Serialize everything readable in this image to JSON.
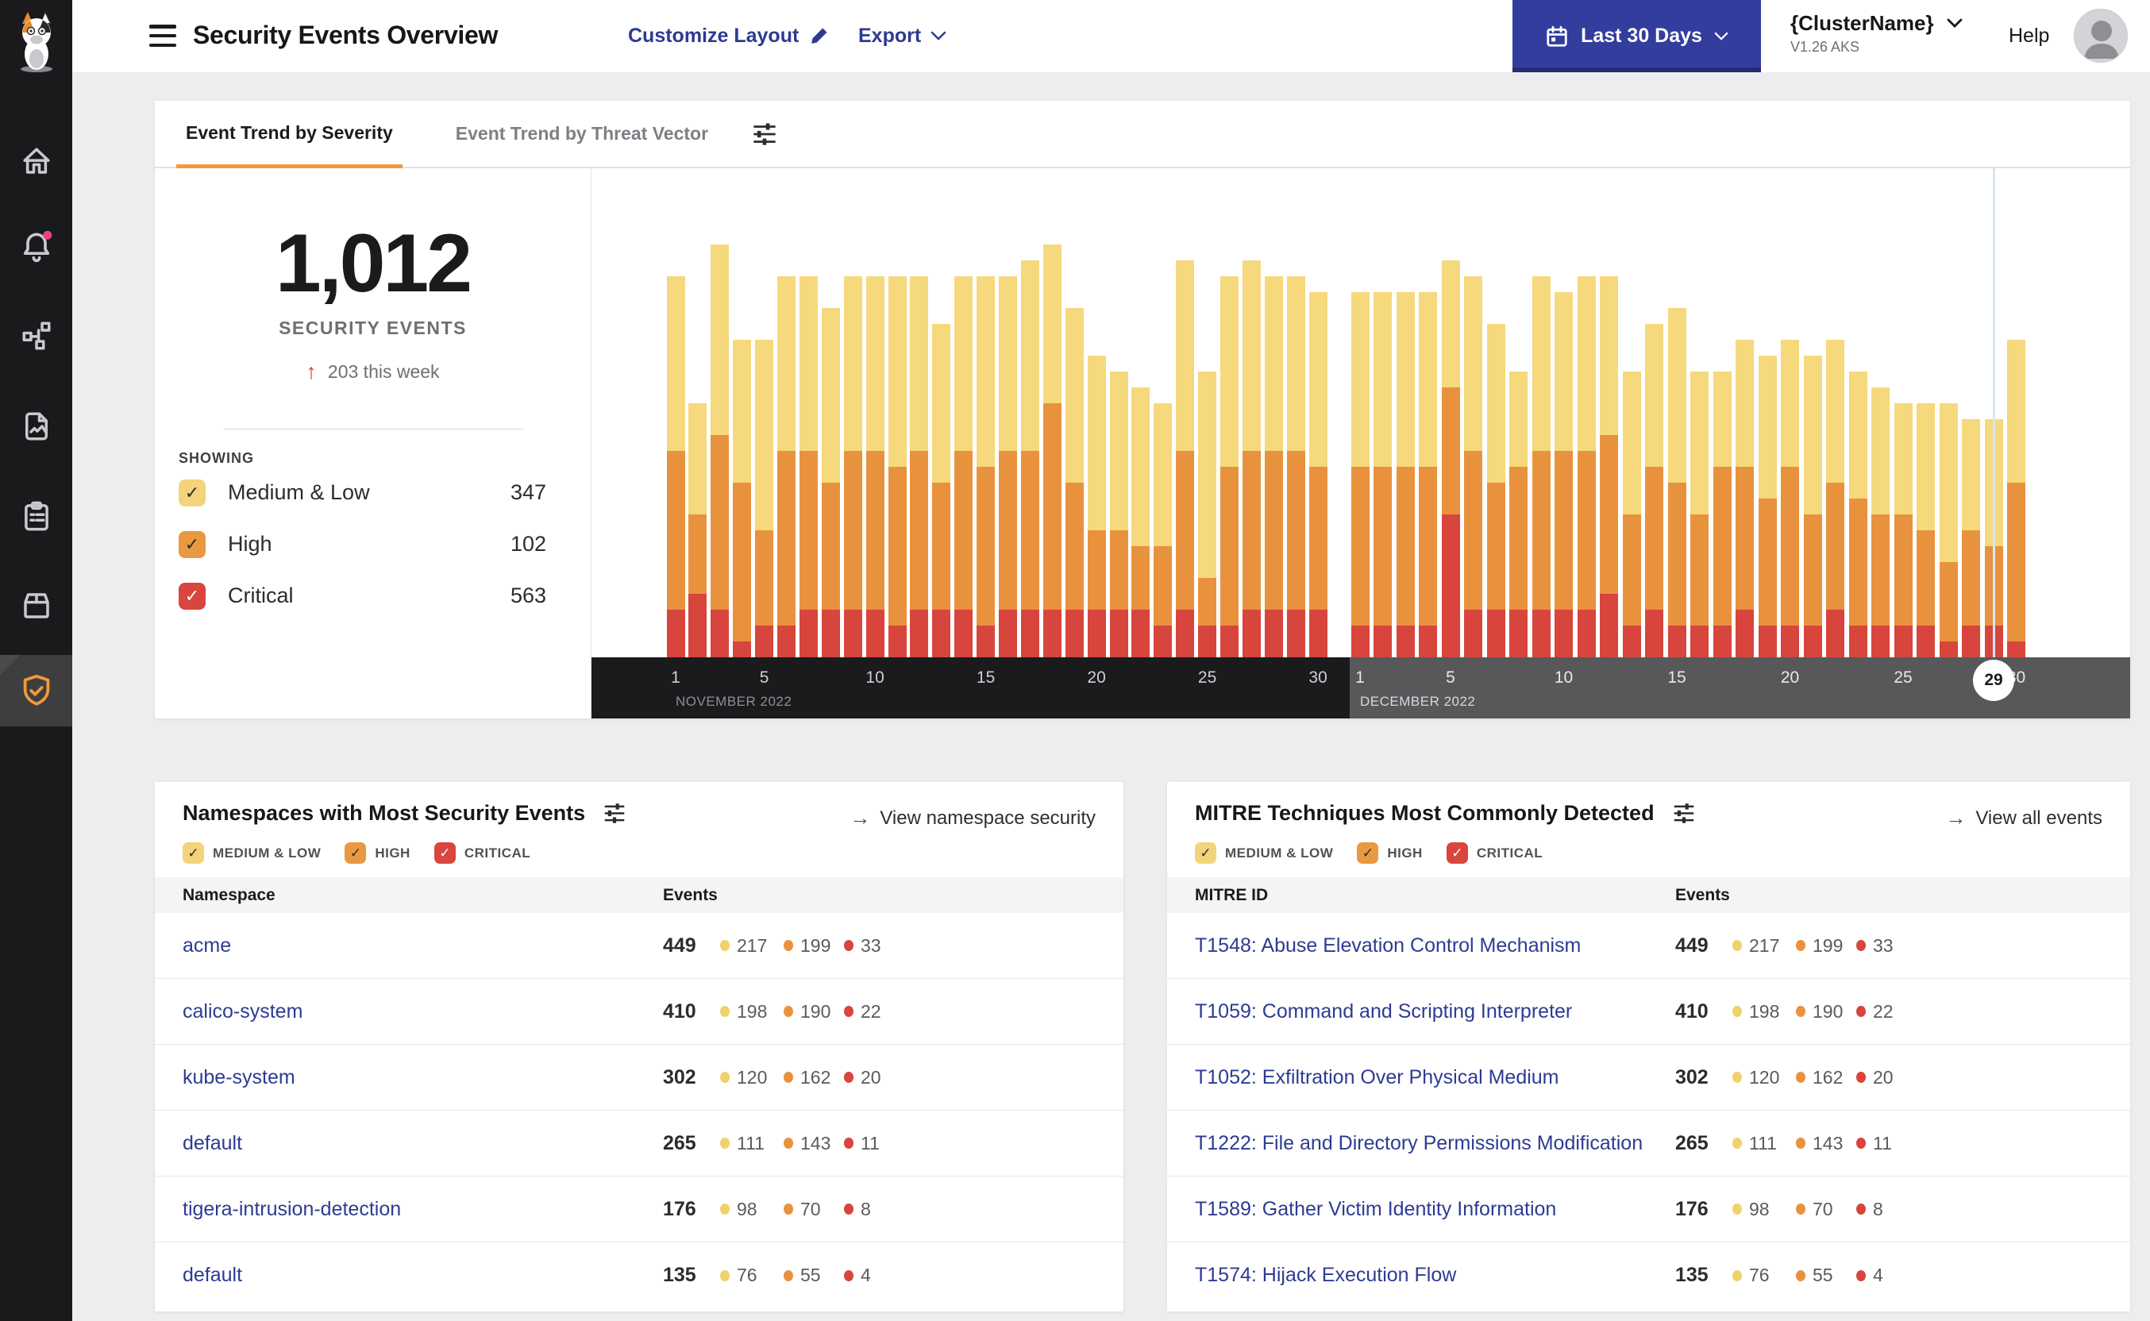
{
  "colors": {
    "medium": "#F6D87D",
    "high": "#E9923E",
    "critical": "#D7453D",
    "accent_orange": "#F09A3C",
    "link_blue": "#2C3A92",
    "button_indigo": "#333D9E",
    "notification_pink": "#F0418C",
    "sidebar_bg": "#1A1A1C",
    "axis_nov_bg": "#1B1B1D",
    "axis_dec_bg": "#58585A"
  },
  "header": {
    "title": "Security Events Overview",
    "customize_label": "Customize Layout",
    "export_label": "Export",
    "date_range_label": "Last 30 Days",
    "cluster_name": "{ClusterName}",
    "cluster_version": "V1.26 AKS",
    "help_label": "Help"
  },
  "trend_card": {
    "tabs": [
      {
        "label": "Event Trend by Severity",
        "active": true
      },
      {
        "label": "Event Trend by Threat Vector",
        "active": false
      }
    ],
    "total": "1,012",
    "total_label": "SECURITY EVENTS",
    "delta_arrow": "↑",
    "delta": "203 this week",
    "showing_label": "SHOWING",
    "showing": [
      {
        "label": "Medium & Low",
        "value": "347",
        "severity": "medium",
        "checked": true
      },
      {
        "label": "High",
        "value": "102",
        "severity": "high",
        "checked": true
      },
      {
        "label": "Critical",
        "value": "563",
        "severity": "critical",
        "checked": true
      }
    ]
  },
  "chart_data": {
    "type": "bar",
    "stacked": true,
    "months": [
      {
        "label": "NOVEMBER 2022",
        "days": 30,
        "tick_days": [
          1,
          5,
          10,
          15,
          20,
          25,
          30
        ]
      },
      {
        "label": "DECEMBER 2022",
        "days": 30,
        "tick_days": [
          1,
          5,
          10,
          15,
          20,
          25,
          30
        ]
      }
    ],
    "selected_day": {
      "month": "DECEMBER 2022",
      "day": 29
    },
    "series": [
      {
        "name": "Medium & Low",
        "color": "#F6D87D",
        "values": [
          11,
          7,
          12,
          9,
          12,
          11,
          11,
          11,
          11,
          11,
          12,
          11,
          10,
          11,
          12,
          11,
          12,
          10,
          11,
          11,
          10,
          10,
          9,
          12,
          13,
          12,
          12,
          11,
          11,
          11,
          11,
          11,
          11,
          11,
          8,
          11,
          10,
          6,
          11,
          10,
          11,
          10,
          9,
          9,
          11,
          9,
          6,
          8,
          9,
          8,
          10,
          9,
          8,
          8,
          7,
          8,
          10,
          7,
          8,
          9
        ]
      },
      {
        "name": "High",
        "color": "#E9923E",
        "values": [
          10,
          5,
          11,
          10,
          6,
          11,
          10,
          8,
          10,
          10,
          10,
          10,
          8,
          10,
          10,
          10,
          10,
          13,
          8,
          5,
          5,
          4,
          5,
          10,
          3,
          10,
          10,
          10,
          10,
          9,
          10,
          10,
          10,
          10,
          8,
          10,
          8,
          9,
          10,
          10,
          10,
          10,
          7,
          9,
          9,
          7,
          10,
          9,
          8,
          10,
          7,
          8,
          8,
          7,
          7,
          6,
          5,
          6,
          5,
          10
        ]
      },
      {
        "name": "Critical",
        "color": "#D7453D",
        "values": [
          3,
          4,
          3,
          1,
          2,
          2,
          3,
          3,
          3,
          3,
          2,
          3,
          3,
          3,
          2,
          3,
          3,
          3,
          3,
          3,
          3,
          3,
          2,
          3,
          2,
          2,
          3,
          3,
          3,
          3,
          2,
          2,
          2,
          2,
          9,
          3,
          3,
          3,
          3,
          3,
          3,
          4,
          2,
          3,
          2,
          2,
          2,
          3,
          2,
          2,
          2,
          3,
          2,
          2,
          2,
          2,
          1,
          2,
          2,
          1
        ]
      }
    ]
  },
  "namespace_card": {
    "title": "Namespaces with Most Security Events",
    "link": "View namespace security",
    "filters": [
      {
        "label": "MEDIUM & LOW",
        "severity": "medium",
        "checked": true
      },
      {
        "label": "HIGH",
        "severity": "high",
        "checked": true
      },
      {
        "label": "CRITICAL",
        "severity": "critical",
        "checked": true
      }
    ],
    "columns": [
      "Namespace",
      "Events"
    ],
    "rows": [
      {
        "label": "acme",
        "total": "449",
        "medium": "217",
        "high": "199",
        "critical": "33"
      },
      {
        "label": "calico-system",
        "total": "410",
        "medium": "198",
        "high": "190",
        "critical": "22"
      },
      {
        "label": "kube-system",
        "total": "302",
        "medium": "120",
        "high": "162",
        "critical": "20"
      },
      {
        "label": "default",
        "total": "265",
        "medium": "111",
        "high": "143",
        "critical": "11"
      },
      {
        "label": "tigera-intrusion-detection",
        "total": "176",
        "medium": "98",
        "high": "70",
        "critical": "8"
      },
      {
        "label": "default",
        "total": "135",
        "medium": "76",
        "high": "55",
        "critical": "4"
      }
    ]
  },
  "mitre_card": {
    "title": "MITRE Techniques Most Commonly Detected",
    "link": "View all events",
    "filters": [
      {
        "label": "MEDIUM & LOW",
        "severity": "medium",
        "checked": true
      },
      {
        "label": "HIGH",
        "severity": "high",
        "checked": true
      },
      {
        "label": "CRITICAL",
        "severity": "critical",
        "checked": true
      }
    ],
    "columns": [
      "MITRE ID",
      "Events"
    ],
    "rows": [
      {
        "label": "T1548: Abuse Elevation Control Mechanism",
        "total": "449",
        "medium": "217",
        "high": "199",
        "critical": "33"
      },
      {
        "label": "T1059: Command and Scripting Interpreter",
        "total": "410",
        "medium": "198",
        "high": "190",
        "critical": "22"
      },
      {
        "label": "T1052: Exfiltration Over Physical Medium",
        "total": "302",
        "medium": "120",
        "high": "162",
        "critical": "20"
      },
      {
        "label": "T1222: File and Directory Permissions Modification",
        "total": "265",
        "medium": "111",
        "high": "143",
        "critical": "11"
      },
      {
        "label": "T1589: Gather Victim Identity Information",
        "total": "176",
        "medium": "98",
        "high": "70",
        "critical": "8"
      },
      {
        "label": "T1574: Hijack Execution Flow",
        "total": "135",
        "medium": "76",
        "high": "55",
        "critical": "4"
      }
    ]
  }
}
